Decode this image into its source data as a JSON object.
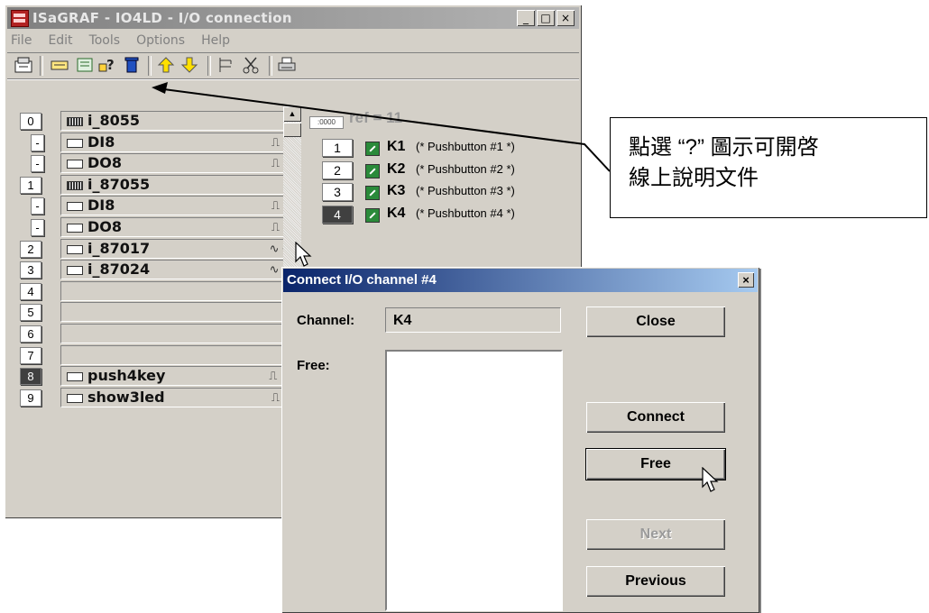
{
  "window": {
    "title": "ISaGRAF - IO4LD - I/O connection",
    "controls": [
      "_",
      "□",
      "×"
    ]
  },
  "menu": [
    "File",
    "Edit",
    "Tools",
    "Options",
    "Help"
  ],
  "toolbar_icons": [
    "open-icon",
    "link-icon",
    "edit-icon",
    "help-icon",
    "delete-icon",
    "up-arrow-icon",
    "down-arrow-icon",
    "tree-icon",
    "cut-icon",
    "print-icon"
  ],
  "slots": [
    {
      "num": "0",
      "name": "i_8055",
      "sig": "",
      "kind": "board",
      "dark": false
    },
    {
      "num": "-",
      "name": "DI8",
      "sig": "⎍ ⇦",
      "kind": "sub",
      "dark": false
    },
    {
      "num": "-",
      "name": "DO8",
      "sig": "⎍ ⇨",
      "kind": "sub",
      "dark": false
    },
    {
      "num": "1",
      "name": "i_87055",
      "sig": "",
      "kind": "board",
      "dark": false
    },
    {
      "num": "-",
      "name": "DI8",
      "sig": "⎍ ⇦",
      "kind": "sub",
      "dark": false
    },
    {
      "num": "-",
      "name": "DO8",
      "sig": "⎍ ⇨",
      "kind": "sub",
      "dark": false
    },
    {
      "num": "2",
      "name": "i_87017",
      "sig": "∿ ⇦",
      "kind": "single",
      "dark": false
    },
    {
      "num": "3",
      "name": "i_87024",
      "sig": "∿ ⇨",
      "kind": "single",
      "dark": false
    },
    {
      "num": "4",
      "name": "",
      "sig": "",
      "kind": "empty",
      "dark": false
    },
    {
      "num": "5",
      "name": "",
      "sig": "",
      "kind": "empty",
      "dark": false
    },
    {
      "num": "6",
      "name": "",
      "sig": "",
      "kind": "empty",
      "dark": false
    },
    {
      "num": "7",
      "name": "",
      "sig": "",
      "kind": "empty",
      "dark": false
    },
    {
      "num": "8",
      "name": "push4key",
      "sig": "⎍ ←",
      "kind": "single",
      "dark": true
    },
    {
      "num": "9",
      "name": "show3led",
      "sig": "⎍ ⇨",
      "kind": "single",
      "dark": false
    }
  ],
  "channels_panel": {
    "ref": "ref = 11",
    "channels": [
      {
        "num": "1",
        "name": "K1",
        "comment": "(* Pushbutton #1 *)",
        "dark": false
      },
      {
        "num": "2",
        "name": "K2",
        "comment": "(* Pushbutton #2 *)",
        "dark": false
      },
      {
        "num": "3",
        "name": "K3",
        "comment": "(* Pushbutton #3 *)",
        "dark": false
      },
      {
        "num": "4",
        "name": "K4",
        "comment": "(* Pushbutton #4 *)",
        "dark": true
      }
    ]
  },
  "callout": {
    "line1": "點選 “?” 圖示可開啓",
    "line2": "線上說明文件"
  },
  "dialog": {
    "title": "Connect I/O channel #4",
    "close_x": "×",
    "channel_label": "Channel:",
    "channel_value": "K4",
    "free_label": "Free:",
    "buttons": {
      "close": "Close",
      "connect": "Connect",
      "free": "Free",
      "next": "Next",
      "previous": "Previous"
    }
  }
}
